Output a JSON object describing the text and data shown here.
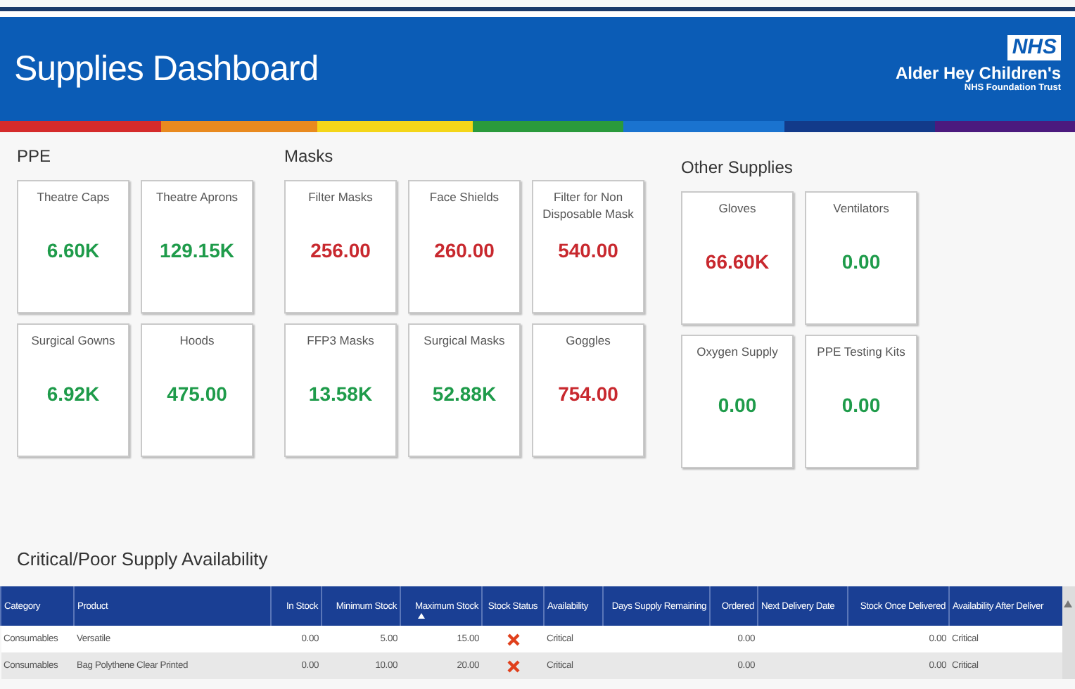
{
  "header": {
    "title": "Supplies Dashboard",
    "logo": {
      "badge": "NHS",
      "name": "Alder Hey Children's",
      "subtitle": "NHS Foundation Trust"
    }
  },
  "sections": [
    {
      "title": "PPE",
      "cards": [
        {
          "label": "Theatre Caps",
          "value": "6.60K",
          "color": "#1e9b4a"
        },
        {
          "label": "Theatre Aprons",
          "value": "129.15K",
          "color": "#1e9b4a"
        },
        {
          "label": "Surgical Gowns",
          "value": "6.92K",
          "color": "#1e9b4a"
        },
        {
          "label": "Hoods",
          "value": "475.00",
          "color": "#1e9b4a"
        }
      ]
    },
    {
      "title": "Masks",
      "cards": [
        {
          "label": "Filter Masks",
          "value": "256.00",
          "color": "#c8282e"
        },
        {
          "label": "Face Shields",
          "value": "260.00",
          "color": "#c8282e"
        },
        {
          "label": "Filter for Non Disposable Mask",
          "value": "540.00",
          "color": "#c8282e"
        },
        {
          "label": "FFP3 Masks",
          "value": "13.58K",
          "color": "#1e9b4a"
        },
        {
          "label": "Surgical Masks",
          "value": "52.88K",
          "color": "#1e9b4a"
        },
        {
          "label": "Goggles",
          "value": "754.00",
          "color": "#c8282e"
        }
      ]
    },
    {
      "title": "Other Supplies",
      "cards": [
        {
          "label": "Gloves",
          "value": "66.60K",
          "color": "#c8282e"
        },
        {
          "label": "Ventilators",
          "value": "0.00",
          "color": "#1e9b4a"
        },
        {
          "label": "Oxygen Supply",
          "value": "0.00",
          "color": "#1e9b4a"
        },
        {
          "label": "PPE Testing Kits",
          "value": "0.00",
          "color": "#1e9b4a"
        }
      ]
    }
  ],
  "table": {
    "title": "Critical/Poor Supply Availability",
    "columns": [
      {
        "label": "Category",
        "sorted": false
      },
      {
        "label": "Product",
        "sorted": false
      },
      {
        "label": "In Stock",
        "sorted": false
      },
      {
        "label": "Minimum Stock",
        "sorted": false
      },
      {
        "label": "Maximum Stock",
        "sorted": true
      },
      {
        "label": "Stock Status",
        "sorted": false
      },
      {
        "label": "Availability",
        "sorted": false
      },
      {
        "label": "Days Supply Remaining",
        "sorted": false
      },
      {
        "label": "Ordered",
        "sorted": false
      },
      {
        "label": "Next Delivery Date",
        "sorted": false
      },
      {
        "label": "Stock Once Delivered",
        "sorted": false
      },
      {
        "label": "Availability After Deliver",
        "sorted": false
      }
    ],
    "rows": [
      {
        "category": "Consumables",
        "product": "Versatile",
        "in_stock": "0.00",
        "minimum_stock": "5.00",
        "maximum_stock": "15.00",
        "stock_critical": true,
        "availability": "Critical",
        "ordered": "0.00",
        "stock_once_delivered": "0.00",
        "availability_after_delivery": "Critical"
      },
      {
        "category": "Consumables",
        "product": "Bag Polythene Clear Printed",
        "in_stock": "0.00",
        "minimum_stock": "10.00",
        "maximum_stock": "20.00",
        "stock_critical": true,
        "availability": "Critical",
        "ordered": "0.00",
        "stock_once_delivered": "0.00",
        "availability_after_delivery": "Critical"
      }
    ]
  }
}
